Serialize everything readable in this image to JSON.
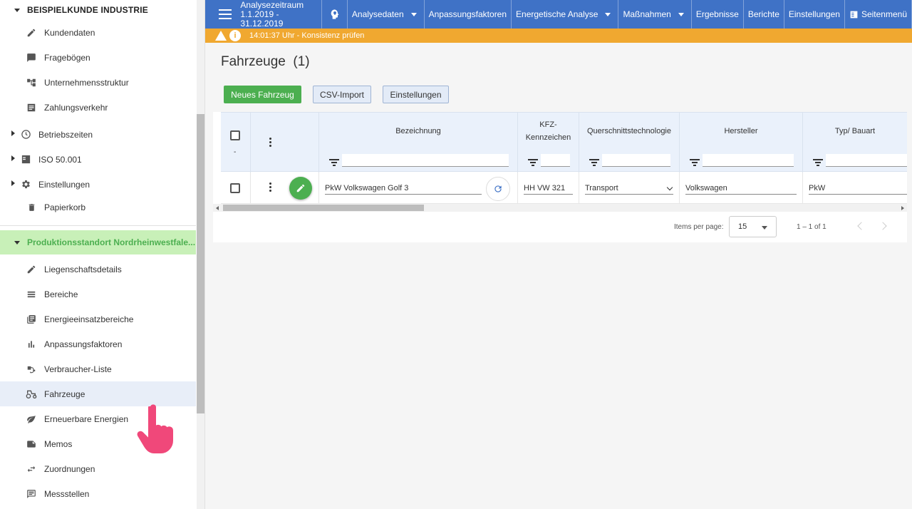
{
  "sidebar": {
    "customer_header": "BEISPIELKUNDE INDUSTRIE",
    "customer_items": [
      {
        "label": "Kundendaten",
        "icon": "pencil-icon"
      },
      {
        "label": "Fragebögen",
        "icon": "chat-icon"
      },
      {
        "label": "Unternehmensstruktur",
        "icon": "hierarchy-icon"
      },
      {
        "label": "Zahlungsverkehr",
        "icon": "list-icon"
      }
    ],
    "expandable_items": [
      {
        "label": "Betriebszeiten",
        "icon": "clock-icon"
      },
      {
        "label": "ISO 50.001",
        "icon": "checklist-icon"
      },
      {
        "label": "Einstellungen",
        "icon": "gear-icon"
      }
    ],
    "trash_label": "Papierkorb",
    "site_header": "Produktionsstandort Nordrheinwestfale...",
    "site_items": [
      {
        "label": "Liegenschaftsdetails",
        "icon": "pencil-icon"
      },
      {
        "label": "Bereiche",
        "icon": "list-icon"
      },
      {
        "label": "Energieeinsatzbereiche",
        "icon": "library-icon"
      },
      {
        "label": "Anpassungsfaktoren",
        "icon": "bar-chart-icon"
      },
      {
        "label": "Verbraucher-Liste",
        "icon": "plug-icon"
      },
      {
        "label": "Fahrzeuge",
        "icon": "tractor-icon",
        "active": true
      },
      {
        "label": "Erneuerbare Energien",
        "icon": "leaf-icon"
      },
      {
        "label": "Memos",
        "icon": "note-icon"
      },
      {
        "label": "Zuordnungen",
        "icon": "swap-icon"
      },
      {
        "label": "Messstellen",
        "icon": "message-icon"
      }
    ]
  },
  "topbar": {
    "period_label": "Analysezeitraum",
    "period_value": "1.1.2019 - 31.12.2019",
    "nav": [
      {
        "label": "Analysedaten",
        "dropdown": true
      },
      {
        "label": "Anpassungsfaktoren",
        "dropdown": false
      },
      {
        "label": "Energetische Analyse",
        "dropdown": true
      },
      {
        "label": "Maßnahmen",
        "dropdown": true
      },
      {
        "label": "Ergebnisse",
        "dropdown": false
      },
      {
        "label": "Berichte",
        "dropdown": false
      },
      {
        "label": "Einstellungen",
        "dropdown": false
      }
    ],
    "page_menu_label": "Seitenmenü"
  },
  "warning": {
    "text": "14:01:37 Uhr - Konsistenz prüfen",
    "info_glyph": "i"
  },
  "main": {
    "title": "Fahrzeuge",
    "count": "(1)",
    "buttons": {
      "new": "Neues Fahrzeug",
      "csv": "CSV-Import",
      "settings": "Einstellungen"
    },
    "table": {
      "select_hint": "-",
      "columns": [
        "Bezeichnung",
        "KFZ-\nKennzeichen",
        "Querschnittstechnologie",
        "Hersteller",
        "Typ/ Bauart"
      ],
      "rows": [
        {
          "bezeichnung": "PkW Volkswagen Golf 3",
          "kennzeichen": "HH VW 321",
          "technologie": "Transport",
          "hersteller": "Volkswagen",
          "typ": "PkW"
        }
      ]
    },
    "paginator": {
      "items_per_page_label": "Items per page:",
      "items_per_page_value": "15",
      "range": "1 – 1 of 1"
    }
  },
  "colors": {
    "primary": "#3f72c6",
    "warning": "#f0a830",
    "success": "#4caf50",
    "site_header_bg": "#c8f0b8",
    "cursor": "#f0487a"
  }
}
